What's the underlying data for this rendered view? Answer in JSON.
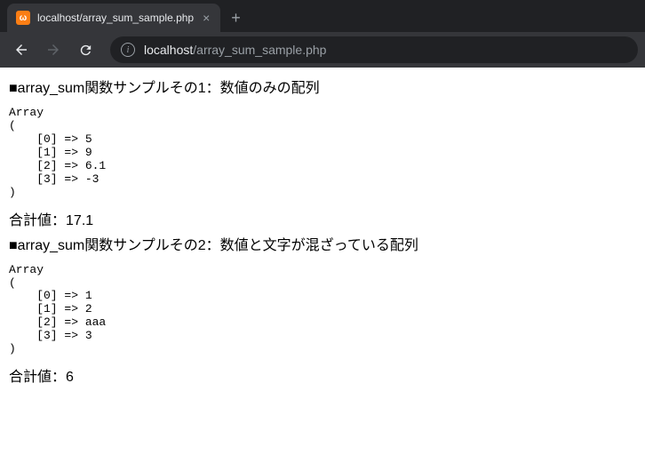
{
  "browser": {
    "tab": {
      "favicon_letter": "ω",
      "title": "localhost/array_sum_sample.php",
      "close": "×"
    },
    "new_tab": "+",
    "nav": {
      "back": "←",
      "forward": "→",
      "reload": "⟳"
    },
    "address": {
      "info": "i",
      "host": "localhost",
      "path": "/array_sum_sample.php"
    }
  },
  "page": {
    "section1": {
      "heading": "array_sum関数サンプルその1：数値のみの配列",
      "dump": "Array\n(\n    [0] => 5\n    [1] => 9\n    [2] => 6.1\n    [3] => -3\n)\n",
      "sum_label": "合計値：",
      "sum_value": "17.1"
    },
    "section2": {
      "heading": "array_sum関数サンプルその2：数値と文字が混ざっている配列",
      "dump": "Array\n(\n    [0] => 1\n    [1] => 2\n    [2] => aaa\n    [3] => 3\n)\n",
      "sum_label": "合計値：",
      "sum_value": "6"
    }
  }
}
